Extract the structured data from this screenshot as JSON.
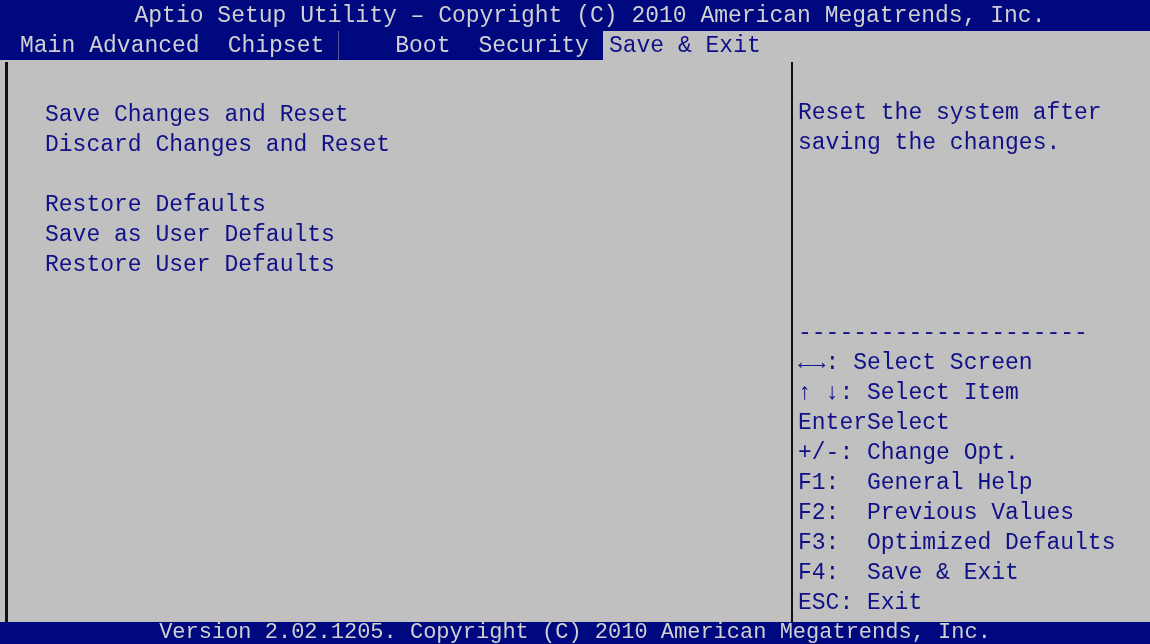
{
  "title": "Aptio Setup Utility – Copyright (C) 2010 American Megatrends, Inc.",
  "tabs": [
    {
      "label": "Main",
      "selected": false
    },
    {
      "label": "Advanced",
      "selected": false
    },
    {
      "label": "Chipset",
      "selected": false
    },
    {
      "label": "Boot",
      "selected": false
    },
    {
      "label": "Security",
      "selected": false
    },
    {
      "label": "Save & Exit",
      "selected": true
    }
  ],
  "menu_groups": [
    {
      "items": [
        "Save Changes and Reset",
        "Discard Changes and Reset"
      ]
    },
    {
      "items": [
        "Restore Defaults",
        "Save as User Defaults",
        "Restore User Defaults"
      ]
    }
  ],
  "help": {
    "description": "Reset the system after saving the changes.",
    "separator": "---------------------",
    "keys": [
      "←→: Select Screen",
      "↑ ↓: Select Item",
      "EnterSelect",
      "+/-: Change Opt.",
      "F1:  General Help",
      "F2:  Previous Values",
      "F3:  Optimized Defaults",
      "F4:  Save & Exit",
      "ESC: Exit"
    ]
  },
  "footer": "Version 2.02.1205. Copyright (C) 2010 American Megatrends, Inc."
}
